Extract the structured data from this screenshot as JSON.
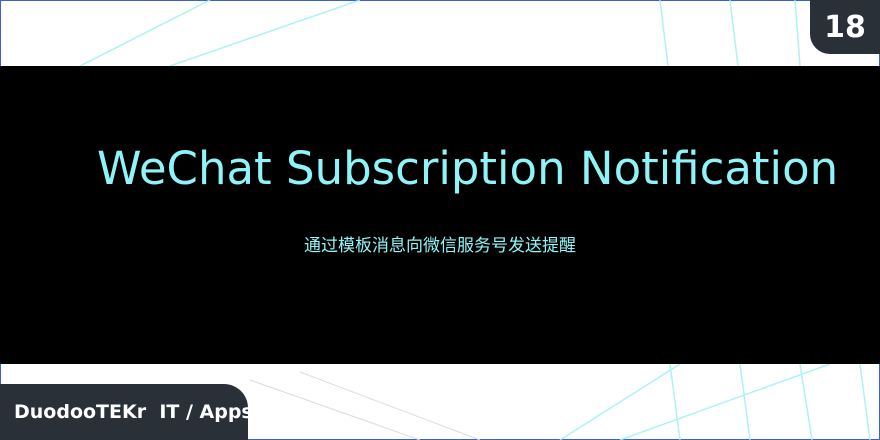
{
  "title": "WeChat Subscription Notification",
  "subtitle": "通过模板消息向微信服务号发送提醒",
  "badge": "18",
  "brand": "DuodooTEKr  IT / Apps",
  "colors": {
    "accent": "#8ff4f7",
    "banner": "#000000",
    "tab": "#2a3038",
    "frame": "#3a5fd6",
    "lines": "#9ff0f5"
  }
}
